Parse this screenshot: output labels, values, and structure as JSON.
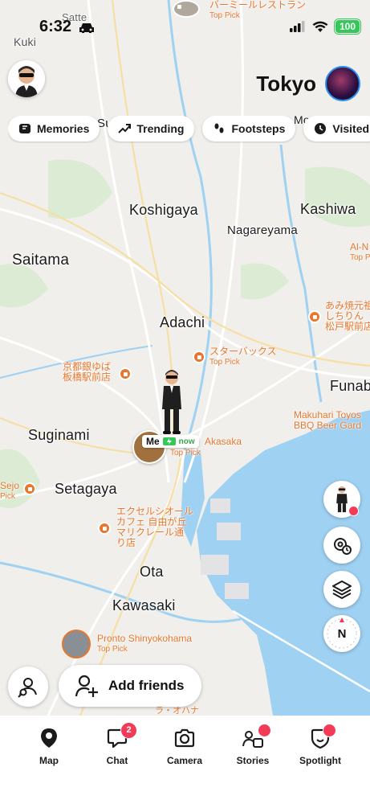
{
  "status_bar": {
    "time": "6:32",
    "battery": "100"
  },
  "header": {
    "location": "Tokyo"
  },
  "chips": [
    "Memories",
    "Trending",
    "Footsteps",
    "Visited"
  ],
  "map": {
    "places": {
      "satte": "Satte",
      "kuki": "Kuki",
      "koshigaya": "Koshigaya",
      "kashiwa": "Kashiwa",
      "nagareyama": "Nagareyama",
      "saitama": "Saitama",
      "adachi": "Adachi",
      "funabashi": "Funab",
      "suginami": "Suginami",
      "akasaka": "Akasaka",
      "setagaya": "Setagaya",
      "ota": "Ota",
      "kawasaki": "Kawasaki",
      "mo": "Mo",
      "su": "Su"
    },
    "pois": {
      "top_restaurant": "バーミールレストラン",
      "top_restaurant_sub": "Top Pick",
      "starbucks": "スターバックス",
      "starbucks_sub": "Top Pick",
      "ainu_1": "あみ焼元祖",
      "ainu_2": "しちりん",
      "ainu_3": "松戸駅前店",
      "al_n": "Al-N",
      "al_n_sub": "Top P",
      "kyoto_1": "京都銀ゆば",
      "kyoto_2": "板橋駅前店",
      "makuhari_1": "Makuhari Toyos",
      "makuhari_2": "BBQ Beer Gard",
      "sejo": "Sejo",
      "sejo_sub": "Pick",
      "excel_1": "エクセルシオール",
      "excel_2": "カフェ 自由が丘",
      "excel_3": "マリクレール通",
      "excel_4": "り店",
      "akasaka_sub": "Top Pick",
      "pronto": "Pronto Shinyokohama",
      "pronto_sub": "Top Pick",
      "bottom_jp": "ラ・オハナ"
    },
    "me": {
      "label": "Me",
      "status": "now"
    },
    "compass": "N"
  },
  "actions": {
    "add_friends": "Add friends"
  },
  "navbar": {
    "items": [
      {
        "label": "Map"
      },
      {
        "label": "Chat",
        "badge": "2"
      },
      {
        "label": "Camera"
      },
      {
        "label": "Stories"
      },
      {
        "label": "Spotlight"
      }
    ]
  },
  "colors": {
    "water": "#9fd1f3",
    "land": "#f0efec",
    "park": "#d7ebcf",
    "accent": "#e8762c",
    "badge": "#f23c57"
  }
}
